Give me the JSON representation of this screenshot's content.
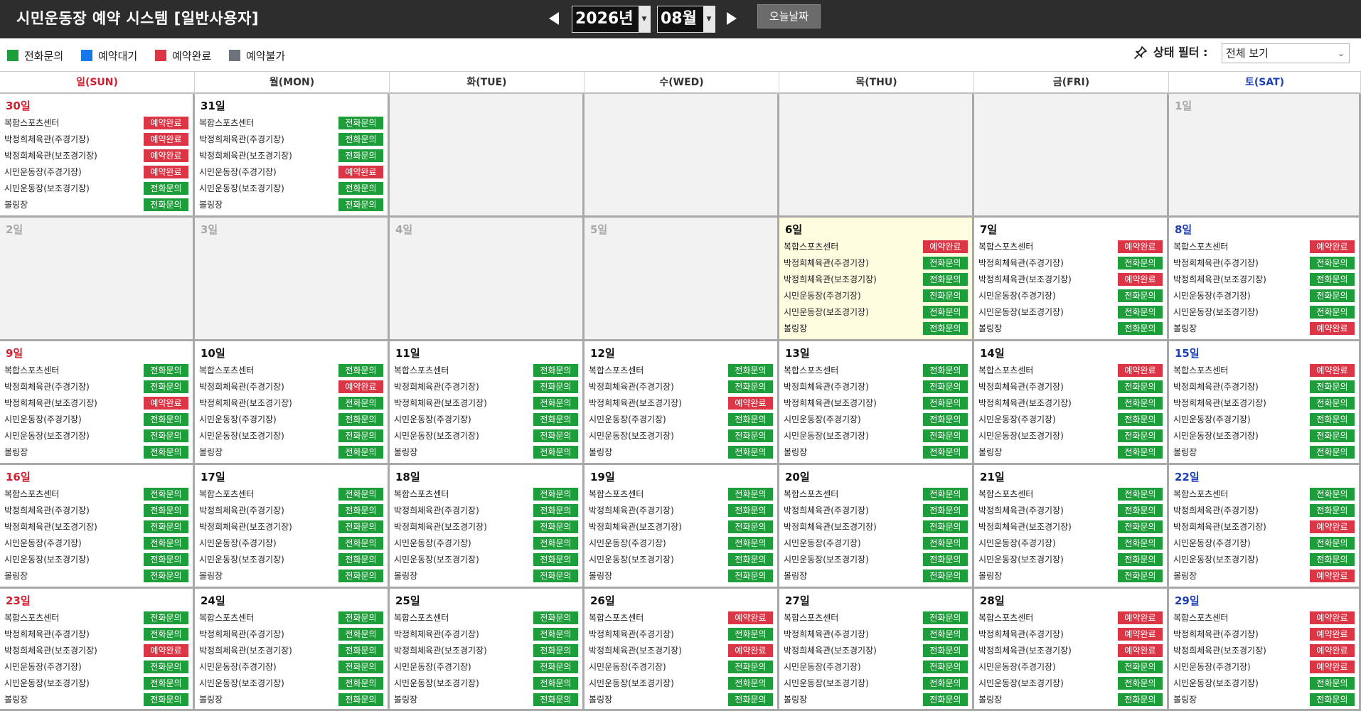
{
  "header": {
    "title": "시민운동장 예약 시스템 [일반사용자]",
    "year_value": "2026년",
    "month_value": "08월",
    "today_label": "오늘날짜",
    "prev_icon": "triangle-left-icon",
    "next_icon": "triangle-right-icon"
  },
  "legend": [
    {
      "label": "전화문의",
      "color": "#1e9e3a"
    },
    {
      "label": "예약대기",
      "color": "#1677e8"
    },
    {
      "label": "예약완료",
      "color": "#dc3545"
    },
    {
      "label": "예약불가",
      "color": "#6c737c"
    }
  ],
  "filter": {
    "label": "상태 필터 :",
    "value": "전체 보기",
    "icon": "pin-icon"
  },
  "weekdays": [
    "일(SUN)",
    "월(MON)",
    "화(TUE)",
    "수(WED)",
    "목(THU)",
    "금(FRI)",
    "토(SAT)"
  ],
  "facilities": [
    "복합스포츠센터",
    "박정희체육관(주경기장)",
    "박정희체육관(보조경기장)",
    "시민운동장(주경기장)",
    "시민운동장(보조경기장)",
    "볼링장"
  ],
  "status_colors": {
    "전화문의": "#1e9e3a",
    "예약완료": "#dc3545"
  },
  "calendar": {
    "weeks": [
      [
        {
          "label": "30일",
          "state": "active",
          "statuses": [
            "예약완료",
            "예약완료",
            "예약완료",
            "예약완료",
            "전화문의",
            "전화문의"
          ]
        },
        {
          "label": "31일",
          "state": "active",
          "statuses": [
            "전화문의",
            "전화문의",
            "전화문의",
            "예약완료",
            "전화문의",
            "전화문의"
          ]
        },
        {
          "label": "",
          "state": "empty",
          "statuses": []
        },
        {
          "label": "",
          "state": "empty",
          "statuses": []
        },
        {
          "label": "",
          "state": "empty",
          "statuses": []
        },
        {
          "label": "",
          "state": "empty",
          "statuses": []
        },
        {
          "label": "1일",
          "state": "disabled",
          "statuses": []
        }
      ],
      [
        {
          "label": "2일",
          "state": "disabled",
          "statuses": []
        },
        {
          "label": "3일",
          "state": "disabled",
          "statuses": []
        },
        {
          "label": "4일",
          "state": "disabled",
          "statuses": []
        },
        {
          "label": "5일",
          "state": "disabled",
          "statuses": []
        },
        {
          "label": "6일",
          "state": "today",
          "statuses": [
            "예약완료",
            "전화문의",
            "전화문의",
            "전화문의",
            "전화문의",
            "전화문의"
          ]
        },
        {
          "label": "7일",
          "state": "active",
          "statuses": [
            "예약완료",
            "전화문의",
            "예약완료",
            "전화문의",
            "전화문의",
            "전화문의"
          ]
        },
        {
          "label": "8일",
          "state": "active",
          "statuses": [
            "예약완료",
            "전화문의",
            "전화문의",
            "전화문의",
            "전화문의",
            "예약완료"
          ]
        }
      ],
      [
        {
          "label": "9일",
          "state": "active",
          "statuses": [
            "전화문의",
            "전화문의",
            "예약완료",
            "전화문의",
            "전화문의",
            "전화문의"
          ]
        },
        {
          "label": "10일",
          "state": "active",
          "statuses": [
            "전화문의",
            "예약완료",
            "전화문의",
            "전화문의",
            "전화문의",
            "전화문의"
          ]
        },
        {
          "label": "11일",
          "state": "active",
          "statuses": [
            "전화문의",
            "전화문의",
            "전화문의",
            "전화문의",
            "전화문의",
            "전화문의"
          ]
        },
        {
          "label": "12일",
          "state": "active",
          "statuses": [
            "전화문의",
            "전화문의",
            "예약완료",
            "전화문의",
            "전화문의",
            "전화문의"
          ]
        },
        {
          "label": "13일",
          "state": "active",
          "statuses": [
            "전화문의",
            "전화문의",
            "전화문의",
            "전화문의",
            "전화문의",
            "전화문의"
          ]
        },
        {
          "label": "14일",
          "state": "active",
          "statuses": [
            "예약완료",
            "전화문의",
            "전화문의",
            "전화문의",
            "전화문의",
            "전화문의"
          ]
        },
        {
          "label": "15일",
          "state": "active",
          "statuses": [
            "예약완료",
            "전화문의",
            "전화문의",
            "전화문의",
            "전화문의",
            "전화문의"
          ]
        }
      ],
      [
        {
          "label": "16일",
          "state": "active",
          "statuses": [
            "전화문의",
            "전화문의",
            "전화문의",
            "전화문의",
            "전화문의",
            "전화문의"
          ]
        },
        {
          "label": "17일",
          "state": "active",
          "statuses": [
            "전화문의",
            "전화문의",
            "전화문의",
            "전화문의",
            "전화문의",
            "전화문의"
          ]
        },
        {
          "label": "18일",
          "state": "active",
          "statuses": [
            "전화문의",
            "전화문의",
            "전화문의",
            "전화문의",
            "전화문의",
            "전화문의"
          ]
        },
        {
          "label": "19일",
          "state": "active",
          "statuses": [
            "전화문의",
            "전화문의",
            "전화문의",
            "전화문의",
            "전화문의",
            "전화문의"
          ]
        },
        {
          "label": "20일",
          "state": "active",
          "statuses": [
            "전화문의",
            "전화문의",
            "전화문의",
            "전화문의",
            "전화문의",
            "전화문의"
          ]
        },
        {
          "label": "21일",
          "state": "active",
          "statuses": [
            "전화문의",
            "전화문의",
            "전화문의",
            "전화문의",
            "전화문의",
            "전화문의"
          ]
        },
        {
          "label": "22일",
          "state": "active",
          "statuses": [
            "전화문의",
            "전화문의",
            "예약완료",
            "전화문의",
            "전화문의",
            "예약완료"
          ]
        }
      ],
      [
        {
          "label": "23일",
          "state": "active",
          "statuses": [
            "전화문의",
            "전화문의",
            "예약완료",
            "전화문의",
            "전화문의",
            "전화문의"
          ]
        },
        {
          "label": "24일",
          "state": "active",
          "statuses": [
            "전화문의",
            "전화문의",
            "전화문의",
            "전화문의",
            "전화문의",
            "전화문의"
          ]
        },
        {
          "label": "25일",
          "state": "active",
          "statuses": [
            "전화문의",
            "전화문의",
            "전화문의",
            "전화문의",
            "전화문의",
            "전화문의"
          ]
        },
        {
          "label": "26일",
          "state": "active",
          "statuses": [
            "예약완료",
            "전화문의",
            "예약완료",
            "전화문의",
            "전화문의",
            "전화문의"
          ]
        },
        {
          "label": "27일",
          "state": "active",
          "statuses": [
            "전화문의",
            "전화문의",
            "전화문의",
            "전화문의",
            "전화문의",
            "전화문의"
          ]
        },
        {
          "label": "28일",
          "state": "active",
          "statuses": [
            "예약완료",
            "예약완료",
            "예약완료",
            "전화문의",
            "전화문의",
            "전화문의"
          ]
        },
        {
          "label": "29일",
          "state": "active",
          "statuses": [
            "예약완료",
            "예약완료",
            "예약완료",
            "예약완료",
            "전화문의",
            "전화문의"
          ]
        }
      ]
    ]
  }
}
